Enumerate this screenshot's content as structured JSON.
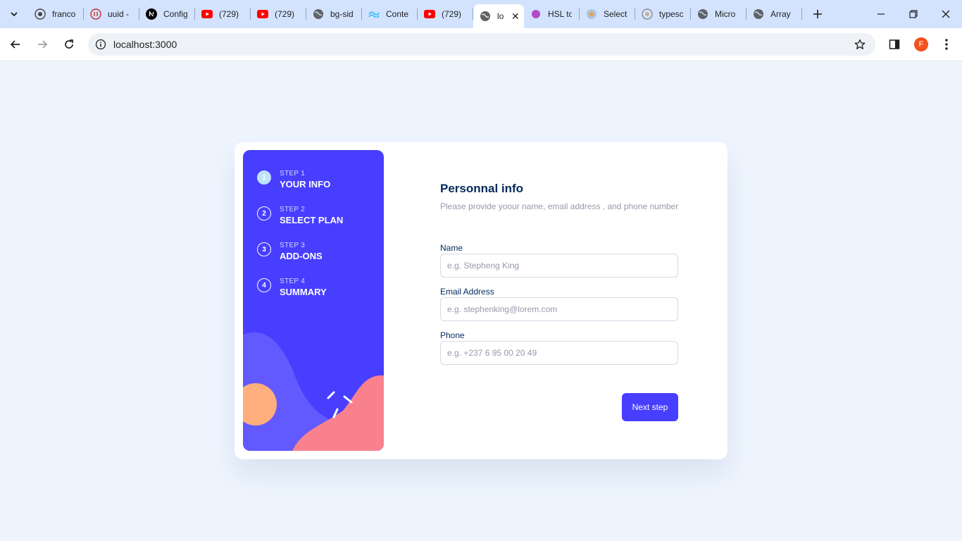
{
  "browser": {
    "tabs": [
      {
        "title": "franco",
        "favicon": "github-icon"
      },
      {
        "title": "uuid -",
        "favicon": "npm-icon"
      },
      {
        "title": "Config",
        "favicon": "nextjs-icon"
      },
      {
        "title": "(729)",
        "favicon": "youtube-icon"
      },
      {
        "title": "(729)",
        "favicon": "youtube-icon"
      },
      {
        "title": "bg-sid",
        "favicon": "globe-icon"
      },
      {
        "title": "Conte",
        "favicon": "tailwind-icon"
      },
      {
        "title": "(729)",
        "favicon": "youtube-icon"
      },
      {
        "title": "lo",
        "favicon": "globe-icon",
        "active": true
      },
      {
        "title": "HSL to",
        "favicon": "purple-dot-icon"
      },
      {
        "title": "Select",
        "favicon": "chrome-web-icon"
      },
      {
        "title": "typesc",
        "favicon": "chrome-web-icon"
      },
      {
        "title": "Micro",
        "favicon": "globe-icon"
      },
      {
        "title": "Array",
        "favicon": "globe-icon"
      }
    ],
    "url": "localhost:3000",
    "profile_initial": "F"
  },
  "sidebar": {
    "steps": [
      {
        "number": "1",
        "label": "STEP 1",
        "name": "YOUR INFO",
        "active": true
      },
      {
        "number": "2",
        "label": "STEP 2",
        "name": "SELECT PLAN"
      },
      {
        "number": "3",
        "label": "STEP 3",
        "name": "ADD-ONS"
      },
      {
        "number": "4",
        "label": "STEP 4",
        "name": "SUMMARY"
      }
    ]
  },
  "form": {
    "title": "Personnal info",
    "subtitle": "Please provide yoour name, email address , and phone number",
    "fields": [
      {
        "label": "Name",
        "placeholder": "e.g. Stepheng King",
        "value": ""
      },
      {
        "label": "Email Address",
        "placeholder": "e.g. stephenking@lorem.com",
        "value": ""
      },
      {
        "label": "Phone",
        "placeholder": "e.g. +237 6 95 00 20 49",
        "value": ""
      }
    ],
    "next_label": "Next step"
  },
  "colors": {
    "accent": "#483eff",
    "page_bg": "#eef5fe",
    "title": "#02295a",
    "muted": "#9699ab",
    "active_step": "#bee2fd",
    "art_orange": "#ffaf7e",
    "art_pink": "#f9818e",
    "art_violet": "#6259ff"
  }
}
